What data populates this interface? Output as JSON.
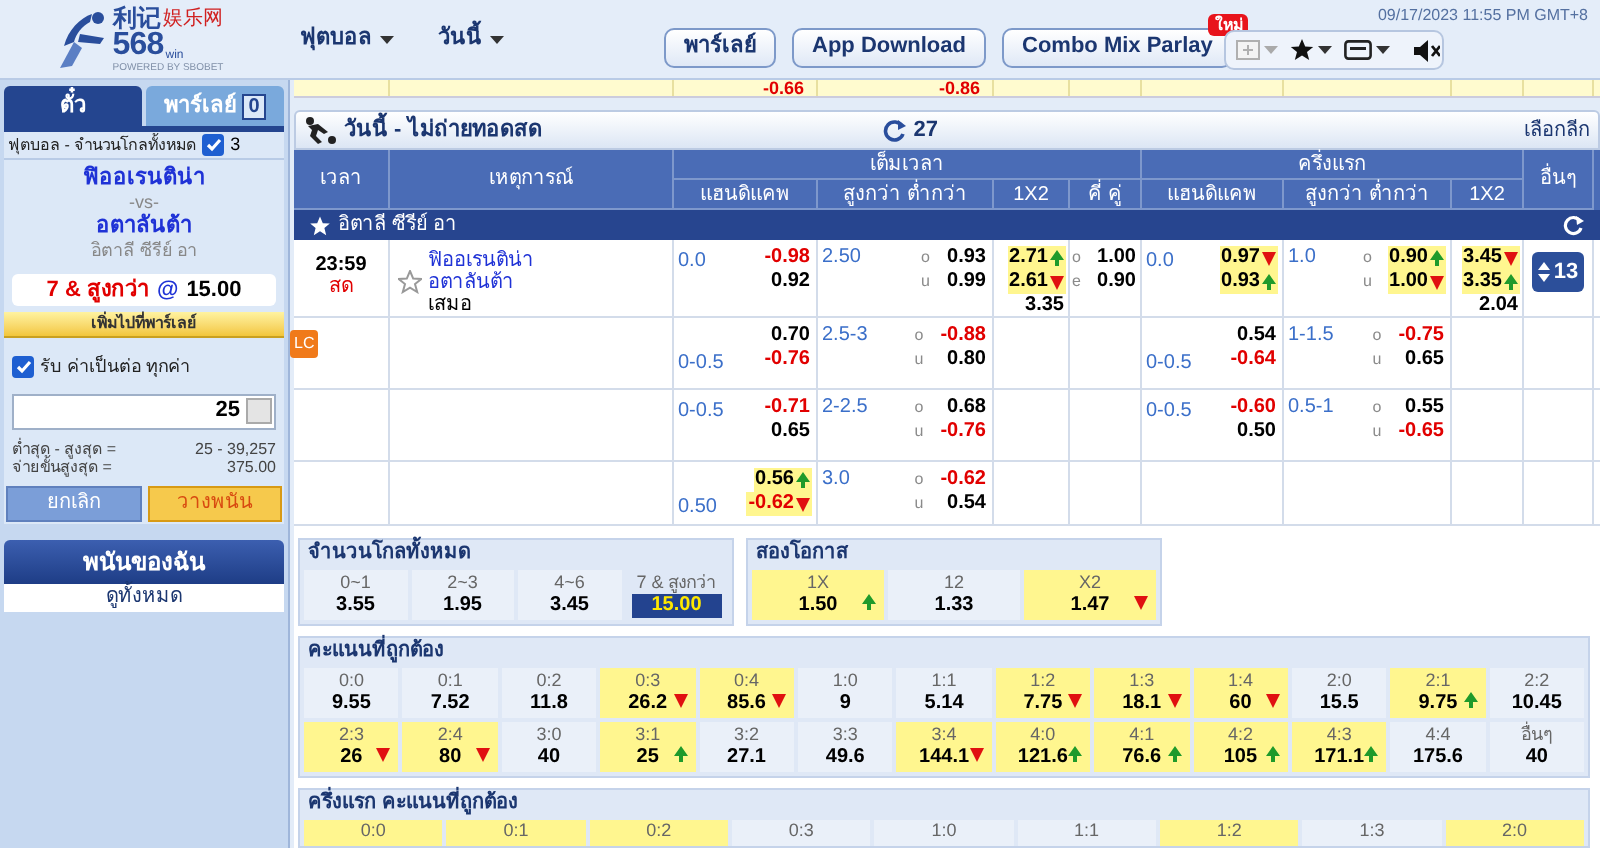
{
  "header": {
    "logo": {
      "brand": "利记",
      "tagline": "娱乐网",
      "number": "568",
      "suffix": "win",
      "powered": "POWERED BY SBOBET"
    },
    "menus": [
      {
        "label": "ฟุตบอล"
      },
      {
        "label": "วันนี้"
      }
    ],
    "buttons": [
      {
        "label": "พาร์เลย์"
      },
      {
        "label": "App Download"
      },
      {
        "label": "Combo Mix Parlay",
        "badge": "ใหม่"
      }
    ],
    "datetime": "09/17/2023 11:55 PM GMT+8"
  },
  "top_strip": {
    "ft_hdp": "-0.66",
    "ft_ou": "-0.86"
  },
  "bet_slip": {
    "tabs": [
      {
        "label": "ตั๋ว",
        "selected": true
      },
      {
        "label": "พาร์เลย์",
        "count": "0",
        "selected": false
      }
    ],
    "market": "ฟุตบอล - จำนวนโกลทั้งหมด",
    "market_checked": true,
    "market_count": "3",
    "home": "ฟิออเรนติน่า",
    "vs": "-vs-",
    "away": "อตาลันต้า",
    "league": "อิตาลี ซีรีย์ อา",
    "selection": "7 & สูงกว่า",
    "at": "@",
    "odds": "15.00",
    "add_parlay": "เพิ่มไปที่พาร์เลย์",
    "accept_checked": true,
    "accept_label": "รับ ค่าเป็นต่อ ทุกค่า",
    "stake": "25",
    "limits": [
      {
        "label": "ต่ำสุด - สูงสุด =",
        "value": "25 - 39,257"
      },
      {
        "label": "จ่ายขั้นสูงสุด =",
        "value": "375.00"
      }
    ],
    "cancel": "ยกเลิก",
    "place": "วางพนัน"
  },
  "my_bets": {
    "title": "พนันของฉัน",
    "link": "ดูทั้งหมด"
  },
  "market_bar": {
    "title": "วันนี้ - ไม่ถ่ายทอดสด",
    "count": "27",
    "select_league": "เลือกลีก"
  },
  "table": {
    "columns": {
      "time": "เวลา",
      "event": "เหตุการณ์",
      "full_time": "เต็มเวลา",
      "first_half": "ครึ่งแรก",
      "others": "อื่นๆ",
      "ft": [
        "แฮนดิแคพ",
        "สูงกว่า ต่ำกว่า",
        "1X2",
        "คี่ คู่"
      ],
      "ht": [
        "แฮนดิแคพ",
        "สูงกว่า ต่ำกว่า",
        "1X2"
      ]
    },
    "league": "อิตาลี ซีรีย์ อา",
    "rows": [
      {
        "time": "23:59",
        "live": "สด",
        "home": "ฟิออเรนติน่า",
        "away": "อตาลันต้า",
        "draw": "เสมอ",
        "others": "13",
        "ft_hdp": {
          "home_line": "0.0",
          "odds": [
            {
              "value": "-0.98",
              "negative": true,
              "rising": false,
              "falling": false
            },
            {
              "value": "0.92",
              "negative": false,
              "rising": false,
              "falling": false
            }
          ]
        },
        "ft_ou": {
          "line": "2.50",
          "marks": [
            "o",
            "u"
          ],
          "odds": [
            {
              "value": "0.93",
              "negative": false,
              "rising": false,
              "falling": false
            },
            {
              "value": "0.99",
              "negative": false,
              "rising": false,
              "falling": false
            }
          ]
        },
        "ft_1x2": [
          {
            "value": "2.71",
            "negative": false,
            "rising": true,
            "falling": false
          },
          {
            "value": "2.61",
            "negative": false,
            "rising": false,
            "falling": true
          },
          {
            "value": "3.35",
            "negative": false,
            "rising": false,
            "falling": false
          }
        ],
        "ft_oe": {
          "marks": [
            "o",
            "e"
          ],
          "odds": [
            {
              "value": "1.00",
              "negative": false,
              "rising": false,
              "falling": false
            },
            {
              "value": "0.90",
              "negative": false,
              "rising": false,
              "falling": false
            }
          ]
        },
        "ht_hdp": {
          "home_line": "0.0",
          "odds": [
            {
              "value": "0.97",
              "negative": false,
              "rising": false,
              "falling": true
            },
            {
              "value": "0.93",
              "negative": false,
              "rising": true,
              "falling": false
            }
          ]
        },
        "ht_ou": {
          "line": "1.0",
          "marks": [
            "o",
            "u"
          ],
          "odds": [
            {
              "value": "0.90",
              "negative": false,
              "rising": true,
              "falling": false
            },
            {
              "value": "1.00",
              "negative": false,
              "rising": false,
              "falling": true
            }
          ]
        },
        "ht_1x2": [
          {
            "value": "3.45",
            "negative": false,
            "rising": false,
            "falling": true
          },
          {
            "value": "3.35",
            "negative": false,
            "rising": true,
            "falling": false
          },
          {
            "value": "2.04",
            "negative": false,
            "rising": false,
            "falling": false
          }
        ]
      },
      {
        "badge": "LC",
        "ft_hdp": {
          "away_line": "0-0.5",
          "odds": [
            {
              "value": "0.70",
              "negative": false,
              "rising": false,
              "falling": false
            },
            {
              "value": "-0.76",
              "negative": true,
              "rising": false,
              "falling": false
            }
          ]
        },
        "ft_ou": {
          "line": "2.5-3",
          "marks": [
            "o",
            "u"
          ],
          "odds": [
            {
              "value": "-0.88",
              "negative": true,
              "rising": false,
              "falling": false
            },
            {
              "value": "0.80",
              "negative": false,
              "rising": false,
              "falling": false
            }
          ]
        },
        "ht_hdp": {
          "away_line": "0-0.5",
          "odds": [
            {
              "value": "0.54",
              "negative": false,
              "rising": false,
              "falling": false
            },
            {
              "value": "-0.64",
              "negative": true,
              "rising": false,
              "falling": false
            }
          ]
        },
        "ht_ou": {
          "line": "1-1.5",
          "marks": [
            "o",
            "u"
          ],
          "odds": [
            {
              "value": "-0.75",
              "negative": true,
              "rising": false,
              "falling": false
            },
            {
              "value": "0.65",
              "negative": false,
              "rising": false,
              "falling": false
            }
          ]
        }
      },
      {
        "ft_hdp": {
          "home_line": "0-0.5",
          "odds": [
            {
              "value": "-0.71",
              "negative": true,
              "rising": false,
              "falling": false
            },
            {
              "value": "0.65",
              "negative": false,
              "rising": false,
              "falling": false
            }
          ]
        },
        "ft_ou": {
          "line": "2-2.5",
          "marks": [
            "o",
            "u"
          ],
          "odds": [
            {
              "value": "0.68",
              "negative": false,
              "rising": false,
              "falling": false
            },
            {
              "value": "-0.76",
              "negative": true,
              "rising": false,
              "falling": false
            }
          ]
        },
        "ht_hdp": {
          "home_line": "0-0.5",
          "odds": [
            {
              "value": "-0.60",
              "negative": true,
              "rising": false,
              "falling": false
            },
            {
              "value": "0.50",
              "negative": false,
              "rising": false,
              "falling": false
            }
          ]
        },
        "ht_ou": {
          "line": "0.5-1",
          "marks": [
            "o",
            "u"
          ],
          "odds": [
            {
              "value": "0.55",
              "negative": false,
              "rising": false,
              "falling": false
            },
            {
              "value": "-0.65",
              "negative": true,
              "rising": false,
              "falling": false
            }
          ]
        }
      },
      {
        "ft_hdp": {
          "away_line": "0.50",
          "odds": [
            {
              "value": "0.56",
              "negative": false,
              "rising": true,
              "falling": false
            },
            {
              "value": "-0.62",
              "negative": true,
              "rising": false,
              "falling": true
            }
          ]
        },
        "ft_ou": {
          "line": "3.0",
          "marks": [
            "o",
            "u"
          ],
          "odds": [
            {
              "value": "-0.62",
              "negative": true,
              "rising": false,
              "falling": false
            },
            {
              "value": "0.54",
              "negative": false,
              "rising": false,
              "falling": false
            }
          ]
        }
      }
    ]
  },
  "total_goals": {
    "title": "จำนวนโกลทั้งหมด",
    "cells": [
      {
        "label": "0~1",
        "value": "3.55",
        "rising": false,
        "falling": false,
        "selected": false
      },
      {
        "label": "2~3",
        "value": "1.95",
        "rising": false,
        "falling": false,
        "selected": false
      },
      {
        "label": "4~6",
        "value": "3.45",
        "rising": false,
        "falling": false,
        "selected": false
      },
      {
        "label": "7 & สูงกว่า",
        "value": "15.00",
        "rising": false,
        "falling": false,
        "selected": true
      }
    ]
  },
  "double_chance": {
    "title": "สองโอกาส",
    "cells": [
      {
        "label": "1X",
        "value": "1.50",
        "rising": true,
        "falling": false,
        "selected": false
      },
      {
        "label": "12",
        "value": "1.33",
        "rising": false,
        "falling": false,
        "selected": false
      },
      {
        "label": "X2",
        "value": "1.47",
        "rising": false,
        "falling": true,
        "selected": false
      }
    ]
  },
  "correct_score": {
    "title": "คะแนนที่ถูกต้อง",
    "rows": [
      [
        {
          "label": "0:0",
          "value": "9.55",
          "rising": false,
          "falling": false
        },
        {
          "label": "0:1",
          "value": "7.52",
          "rising": false,
          "falling": false
        },
        {
          "label": "0:2",
          "value": "11.8",
          "rising": false,
          "falling": false
        },
        {
          "label": "0:3",
          "value": "26.2",
          "rising": false,
          "falling": true
        },
        {
          "label": "0:4",
          "value": "85.6",
          "rising": false,
          "falling": true
        },
        {
          "label": "1:0",
          "value": "9",
          "rising": false,
          "falling": false
        },
        {
          "label": "1:1",
          "value": "5.14",
          "rising": false,
          "falling": false
        },
        {
          "label": "1:2",
          "value": "7.75",
          "rising": false,
          "falling": true
        },
        {
          "label": "1:3",
          "value": "18.1",
          "rising": false,
          "falling": true
        },
        {
          "label": "1:4",
          "value": "60",
          "rising": false,
          "falling": true
        },
        {
          "label": "2:0",
          "value": "15.5",
          "rising": false,
          "falling": false
        },
        {
          "label": "2:1",
          "value": "9.75",
          "rising": true,
          "falling": false
        },
        {
          "label": "2:2",
          "value": "10.45",
          "rising": false,
          "falling": false
        }
      ],
      [
        {
          "label": "2:3",
          "value": "26",
          "rising": false,
          "falling": true
        },
        {
          "label": "2:4",
          "value": "80",
          "rising": false,
          "falling": true
        },
        {
          "label": "3:0",
          "value": "40",
          "rising": false,
          "falling": false
        },
        {
          "label": "3:1",
          "value": "25",
          "rising": true,
          "falling": false
        },
        {
          "label": "3:2",
          "value": "27.1",
          "rising": false,
          "falling": false
        },
        {
          "label": "3:3",
          "value": "49.6",
          "rising": false,
          "falling": false
        },
        {
          "label": "3:4",
          "value": "144.1",
          "rising": false,
          "falling": true
        },
        {
          "label": "4:0",
          "value": "121.6",
          "rising": true,
          "falling": false
        },
        {
          "label": "4:1",
          "value": "76.6",
          "rising": true,
          "falling": false
        },
        {
          "label": "4:2",
          "value": "105",
          "rising": true,
          "falling": false
        },
        {
          "label": "4:3",
          "value": "171.1",
          "rising": true,
          "falling": false
        },
        {
          "label": "4:4",
          "value": "175.6",
          "rising": false,
          "falling": false
        },
        {
          "label": "อื่นๆ",
          "value": "40",
          "rising": false,
          "falling": false
        }
      ]
    ]
  },
  "first_half_correct_score": {
    "title": "ครึ่งแรก คะแนนที่ถูกต้อง",
    "cells": [
      {
        "label": "0:0",
        "highlight": true
      },
      {
        "label": "0:1",
        "highlight": true
      },
      {
        "label": "0:2",
        "highlight": true
      },
      {
        "label": "0:3",
        "highlight": false
      },
      {
        "label": "1:0",
        "highlight": false
      },
      {
        "label": "1:1",
        "highlight": false
      },
      {
        "label": "1:2",
        "highlight": true
      },
      {
        "label": "1:3",
        "highlight": false
      },
      {
        "label": "2:0",
        "highlight": true
      }
    ]
  }
}
